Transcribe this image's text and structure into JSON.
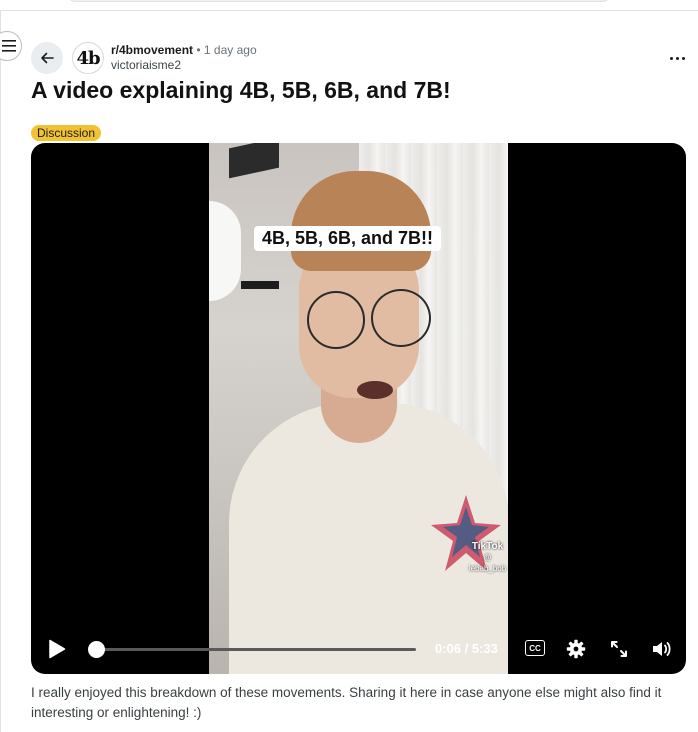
{
  "post": {
    "subreddit": "r/4bmovement",
    "separator": "•",
    "time": "1 day ago",
    "author": "victoriaisme2",
    "avatar_text": "4b",
    "title": "A video explaining 4B, 5B, 6B, and 7B!",
    "flair": "Discussion",
    "body": "I really enjoyed this breakdown of these movements. Sharing it here in case anyone else might also find it interesting or enlightening! :)"
  },
  "video": {
    "caption": "4B, 5B, 6B, and 7B!!",
    "watermark_brand": "TikTok",
    "watermark_handle": "@ lebab_bob",
    "time_display": "0:06 / 5:33",
    "progress": 0.018,
    "cc_label": "CC"
  },
  "colors": {
    "flair": "#f1c232",
    "video_bg": "#000000"
  },
  "icons": {
    "menu": "hamburger-icon",
    "back": "arrow-left-icon",
    "more": "more-horizontal-icon",
    "play": "play-icon",
    "settings": "gear-icon",
    "fullscreen": "fullscreen-icon",
    "volume": "volume-icon"
  }
}
